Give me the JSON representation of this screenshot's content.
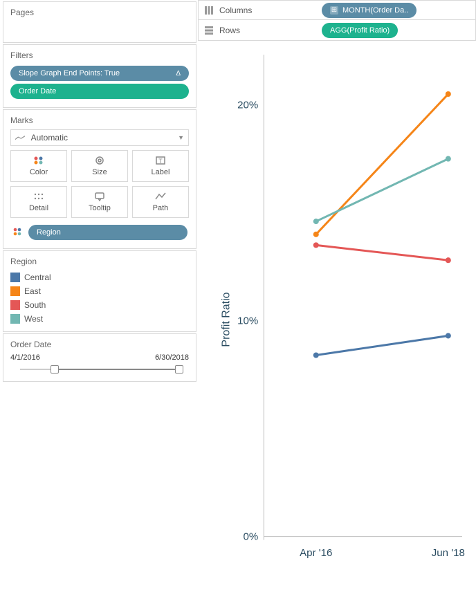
{
  "panels": {
    "pages_title": "Pages",
    "filters_title": "Filters",
    "marks_title": "Marks",
    "region_title": "Region",
    "order_date_title": "Order Date"
  },
  "filters": {
    "pill1": "Slope Graph End Points: True",
    "pill1_delta": "Δ",
    "pill2": "Order Date"
  },
  "marks": {
    "dropdown": "Automatic",
    "btn_color": "Color",
    "btn_size": "Size",
    "btn_label": "Label",
    "btn_detail": "Detail",
    "btn_tooltip": "Tooltip",
    "btn_path": "Path",
    "region_pill": "Region"
  },
  "legend": {
    "items": [
      {
        "label": "Central",
        "color": "#4C78A8"
      },
      {
        "label": "East",
        "color": "#F58518"
      },
      {
        "label": "South",
        "color": "#E45756"
      },
      {
        "label": "West",
        "color": "#72B7B2"
      }
    ]
  },
  "date_filter": {
    "start": "4/1/2016",
    "end": "6/30/2018"
  },
  "shelves": {
    "columns_label": "Columns",
    "columns_pill": "MONTH(Order Da..",
    "rows_label": "Rows",
    "rows_pill": "AGG(Profit Ratio)"
  },
  "chart_data": {
    "type": "line",
    "ylabel": "Profit Ratio",
    "xlabel": "",
    "title": "",
    "categories": [
      "Apr '16",
      "Jun '18"
    ],
    "y_ticks": [
      "0%",
      "10%",
      "20%"
    ],
    "ylim": [
      0,
      22
    ],
    "series": [
      {
        "name": "Central",
        "color": "#4C78A8",
        "values": [
          8.4,
          9.3
        ]
      },
      {
        "name": "East",
        "color": "#F58518",
        "values": [
          14.0,
          20.5
        ]
      },
      {
        "name": "South",
        "color": "#E45756",
        "values": [
          13.5,
          12.8
        ]
      },
      {
        "name": "West",
        "color": "#72B7B2",
        "values": [
          14.6,
          17.5
        ]
      }
    ]
  }
}
